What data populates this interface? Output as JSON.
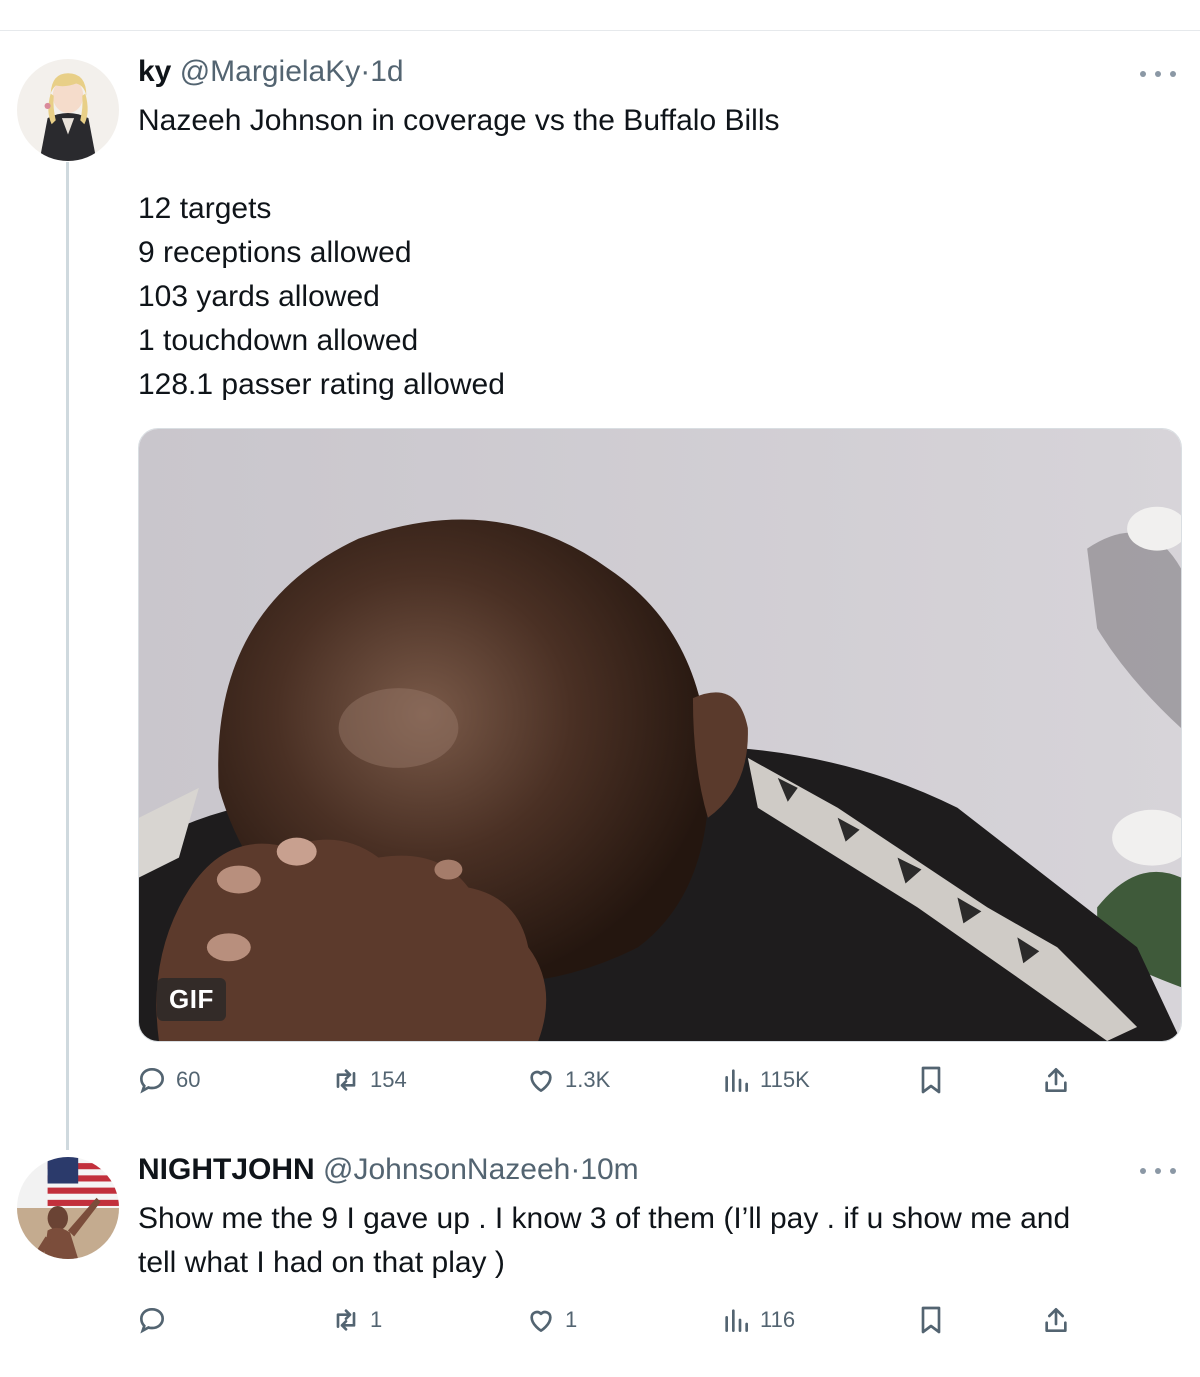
{
  "tweets": [
    {
      "name": "ky",
      "handle": "@MargielaKy",
      "separator": "·",
      "time": "1d",
      "text_lines": [
        "Nazeeh Johnson in coverage vs the Buffalo Bills",
        "",
        "12 targets",
        "9 receptions allowed",
        "103 yards allowed",
        "1 touchdown allowed",
        "128.1 passer rating allowed"
      ],
      "media_badge": "GIF",
      "actions": {
        "replies": "60",
        "reposts": "154",
        "likes": "1.3K",
        "views": "115K"
      }
    },
    {
      "name": "NIGHTJOHN",
      "handle": "@JohnsonNazeeh",
      "separator": "·",
      "time": "10m",
      "text_lines": [
        "Show me the 9 I gave up . I know 3 of them (I’ll pay . if u show me and",
        "tell what I had on that play )"
      ],
      "actions": {
        "replies": "",
        "reposts": "1",
        "likes": "1",
        "views": "116"
      }
    }
  ],
  "colors": {
    "text": "#0f1419",
    "secondary": "#536471",
    "thread_line": "#cfd9de"
  },
  "icons": [
    "reply-icon",
    "repost-icon",
    "like-icon",
    "views-icon",
    "bookmark-icon",
    "share-icon",
    "more-icon"
  ]
}
